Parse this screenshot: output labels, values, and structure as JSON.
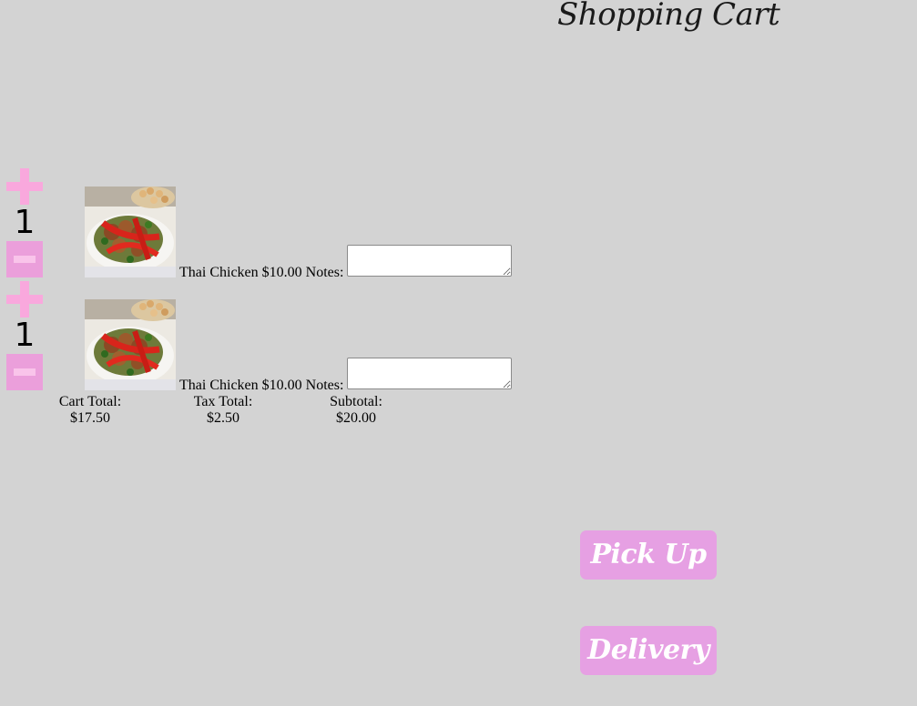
{
  "page": {
    "title": "Shopping Cart"
  },
  "cart": {
    "items": [
      {
        "quantity": "1",
        "image_icon": "thai-chicken-food-photo",
        "text": "Thai Chicken $10.00 Notes:",
        "notes_value": ""
      },
      {
        "quantity": "1",
        "image_icon": "thai-chicken-food-photo",
        "text": "Thai Chicken $10.00 Notes:",
        "notes_value": ""
      }
    ]
  },
  "totals": {
    "cart_total_label": "Cart Total:",
    "cart_total_value": "$17.50",
    "tax_total_label": "Tax Total:",
    "tax_total_value": "$2.50",
    "subtotal_label": "Subtotal:",
    "subtotal_value": "$20.00"
  },
  "actions": {
    "pickup_label": "Pick Up",
    "delivery_label": "Delivery"
  },
  "colors": {
    "background": "#d3d3d3",
    "plus": "#f9a8dd",
    "minus": "#eb9fdb",
    "button": "#e6a0e3",
    "button_text": "#ffffff"
  }
}
